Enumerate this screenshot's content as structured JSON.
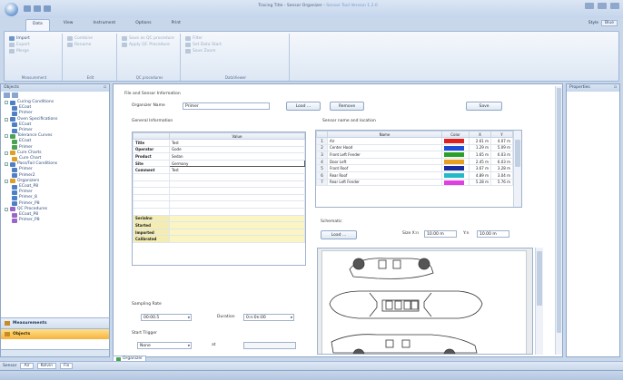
{
  "window": {
    "title": "Tracing Title - Sensor Organizer",
    "product": "Sensor Tool Version 1.2.0"
  },
  "tabs": [
    "Data",
    "View",
    "Instrument",
    "Options",
    "Print"
  ],
  "active_tab": 0,
  "style_picker": {
    "label": "Style",
    "value": "Blue"
  },
  "ribbon": {
    "groups": [
      {
        "label": "Measurement",
        "buttons": [
          "Import",
          "Export",
          "Merge"
        ]
      },
      {
        "label": "Edit",
        "buttons": [
          "Combine",
          "Rename"
        ]
      },
      {
        "label": "QC procedures",
        "buttons": [
          "Save as QC procedure",
          "Apply QC Procedure"
        ]
      },
      {
        "label": "DataViewer",
        "buttons": [
          "Filter",
          "Set Data Start",
          "Save Zoom"
        ]
      }
    ]
  },
  "left_panel": {
    "title": "Objects",
    "tree": [
      {
        "depth": 0,
        "label": "Curing Conditions",
        "icon": "folder-icon",
        "color": "b",
        "ex": "-"
      },
      {
        "depth": 1,
        "label": "ECoat",
        "icon": "doc-icon",
        "color": "b"
      },
      {
        "depth": 1,
        "label": "Primer",
        "icon": "doc-icon",
        "color": "b"
      },
      {
        "depth": 0,
        "label": "Oven Specifications",
        "icon": "folder-icon",
        "color": "b",
        "ex": "-"
      },
      {
        "depth": 1,
        "label": "ECoat",
        "icon": "doc-icon",
        "color": "b"
      },
      {
        "depth": 1,
        "label": "Primer",
        "icon": "doc-icon",
        "color": "b"
      },
      {
        "depth": 0,
        "label": "Tolerance Curves",
        "icon": "folder-icon",
        "color": "g",
        "ex": "-"
      },
      {
        "depth": 1,
        "label": "ECoat",
        "icon": "doc-icon",
        "color": "g"
      },
      {
        "depth": 1,
        "label": "Primer",
        "icon": "doc-icon",
        "color": "g"
      },
      {
        "depth": 0,
        "label": "Cure Charts",
        "icon": "folder-icon",
        "color": "o",
        "ex": "-"
      },
      {
        "depth": 1,
        "label": "Cure Chart",
        "icon": "doc-icon",
        "color": "o"
      },
      {
        "depth": 0,
        "label": "Pass/Fail Conditions",
        "icon": "folder-icon",
        "color": "b",
        "ex": "-"
      },
      {
        "depth": 1,
        "label": "Primer",
        "icon": "doc-icon",
        "color": "b"
      },
      {
        "depth": 1,
        "label": "Primer2",
        "icon": "doc-icon",
        "color": "b"
      },
      {
        "depth": 0,
        "label": "Organizers",
        "icon": "folder-icon",
        "color": "o",
        "ex": "-"
      },
      {
        "depth": 1,
        "label": "ECoat_P8",
        "icon": "doc-icon",
        "color": "b"
      },
      {
        "depth": 1,
        "label": "Primer",
        "icon": "doc-icon",
        "color": "b"
      },
      {
        "depth": 1,
        "label": "Primer_8",
        "icon": "doc-icon",
        "color": "b"
      },
      {
        "depth": 1,
        "label": "Primer_P8",
        "icon": "doc-icon",
        "color": "b"
      },
      {
        "depth": 0,
        "label": "QC Procedures",
        "icon": "folder-icon",
        "color": "p",
        "ex": "-"
      },
      {
        "depth": 1,
        "label": "ECoat_P8",
        "icon": "doc-icon",
        "color": "p"
      },
      {
        "depth": 1,
        "label": "Primer_P8",
        "icon": "doc-icon",
        "color": "p"
      }
    ],
    "nav": [
      "Measurements",
      "Objects"
    ],
    "active_nav": 1
  },
  "form": {
    "section_title": "File and Sensor Information",
    "organizer_name_label": "Organizer Name",
    "organizer_name": "Primer",
    "load_button": "Load ...",
    "remove_button": "Remove",
    "save_button": "Save",
    "general_title": "General Information",
    "info_header": "Value",
    "info_rows": [
      {
        "key": "Title",
        "value": "Test",
        "yellow": false
      },
      {
        "key": "Operator",
        "value": "Gode",
        "yellow": false
      },
      {
        "key": "Product",
        "value": "Sedan",
        "yellow": false
      },
      {
        "key": "Site",
        "value": "Germany",
        "yellow": false
      },
      {
        "key": "Comment",
        "value": "Test",
        "yellow": false
      },
      {
        "key": "",
        "value": "",
        "yellow": false
      },
      {
        "key": "",
        "value": "",
        "yellow": false
      },
      {
        "key": "",
        "value": "",
        "yellow": false
      },
      {
        "key": "",
        "value": "",
        "yellow": false
      },
      {
        "key": "",
        "value": "",
        "yellow": false
      },
      {
        "key": "",
        "value": "",
        "yellow": false
      },
      {
        "key": "Serialno",
        "value": "",
        "yellow": true
      },
      {
        "key": "Started",
        "value": "",
        "yellow": true
      },
      {
        "key": "Imported",
        "value": "",
        "yellow": true
      },
      {
        "key": "Calibrated",
        "value": "",
        "yellow": true
      }
    ],
    "sampling_rate_label": "Sampling Rate",
    "sampling_rate": "00:00.5",
    "duration_label": "Duration",
    "duration": "0:n:0n:00",
    "start_trigger_label": "Start Trigger",
    "start_trigger": "None",
    "at_label": "at",
    "sensor_title": "Sensor name and location",
    "sensor_headers": [
      "",
      "Name",
      "Color",
      "X",
      "Y"
    ],
    "sensors": [
      {
        "n": "1",
        "name": "Air",
        "color": "#e02020",
        "x": "2.61 m",
        "y": "4.07 m"
      },
      {
        "n": "2",
        "name": "Center Hood",
        "color": "#1f4fd8",
        "x": "1.29 m",
        "y": "5.09 m"
      },
      {
        "n": "3",
        "name": "Front Left Fender",
        "color": "#2aa02a",
        "x": "1.65 m",
        "y": "6.03 m"
      },
      {
        "n": "4",
        "name": "Door Left",
        "color": "#e8a020",
        "x": "2.45 m",
        "y": "6.03 m"
      },
      {
        "n": "5",
        "name": "Front Roof",
        "color": "#1a2aa0",
        "x": "3.67 m",
        "y": "3.28 m"
      },
      {
        "n": "6",
        "name": "Rear Roof",
        "color": "#24b8c8",
        "x": "4.89 m",
        "y": "3.04 m"
      },
      {
        "n": "7",
        "name": "Rear Left Fender",
        "color": "#e040e0",
        "x": "5.28 m",
        "y": "5.76 m"
      }
    ],
    "schematic_label": "Schematic",
    "schematic_load": "Load ...",
    "size_label": "Size X:n",
    "size_x": "10.00 m",
    "y_label": "Y:n",
    "size_y": "10.00 m"
  },
  "right_panel": {
    "title": "Properties"
  },
  "doc_tab": "Organizer",
  "status": {
    "label": "Sensor",
    "value": "Air",
    "unit": "Kelvin",
    "extra": "Fix"
  }
}
